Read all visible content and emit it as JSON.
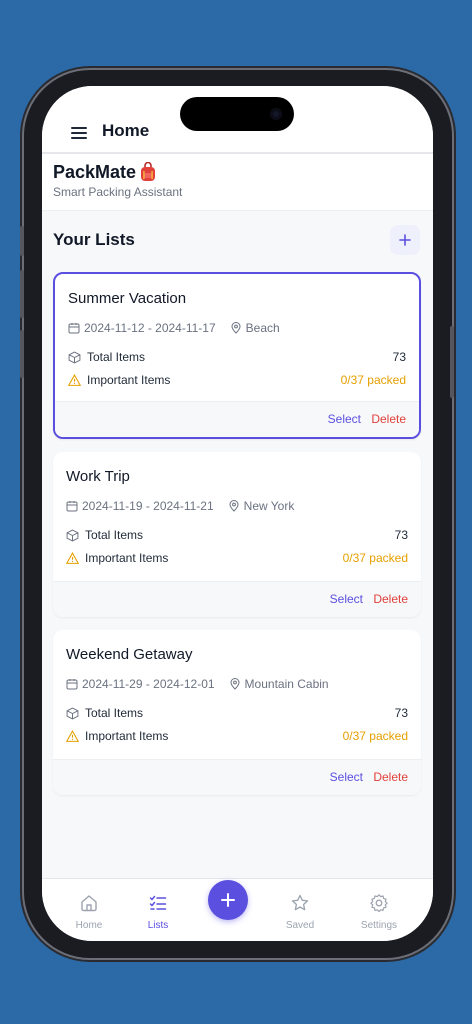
{
  "header": {
    "title": "Home"
  },
  "brand": {
    "name": "PackMate",
    "emoji_icon": "backpack-icon",
    "subtitle": "Smart Packing Assistant"
  },
  "section": {
    "title": "Your Lists"
  },
  "lists": [
    {
      "title": "Summer Vacation",
      "dates": "2024-11-12 - 2024-11-17",
      "location": "Beach",
      "total_label": "Total Items",
      "total_value": "73",
      "important_label": "Important Items",
      "important_value": "0/37 packed",
      "select_label": "Select",
      "delete_label": "Delete"
    },
    {
      "title": "Work Trip",
      "dates": "2024-11-19 - 2024-11-21",
      "location": "New York",
      "total_label": "Total Items",
      "total_value": "73",
      "important_label": "Important Items",
      "important_value": "0/37 packed",
      "select_label": "Select",
      "delete_label": "Delete"
    },
    {
      "title": "Weekend Getaway",
      "dates": "2024-11-29 - 2024-12-01",
      "location": "Mountain Cabin",
      "total_label": "Total Items",
      "total_value": "73",
      "important_label": "Important Items",
      "important_value": "0/37 packed",
      "select_label": "Select",
      "delete_label": "Delete"
    }
  ],
  "nav": {
    "home": "Home",
    "lists": "Lists",
    "saved": "Saved",
    "settings": "Settings"
  },
  "colors": {
    "accent": "#5b4fe0",
    "warning": "#e5a000",
    "danger": "#e0413a",
    "background": "#2b6aa6"
  }
}
